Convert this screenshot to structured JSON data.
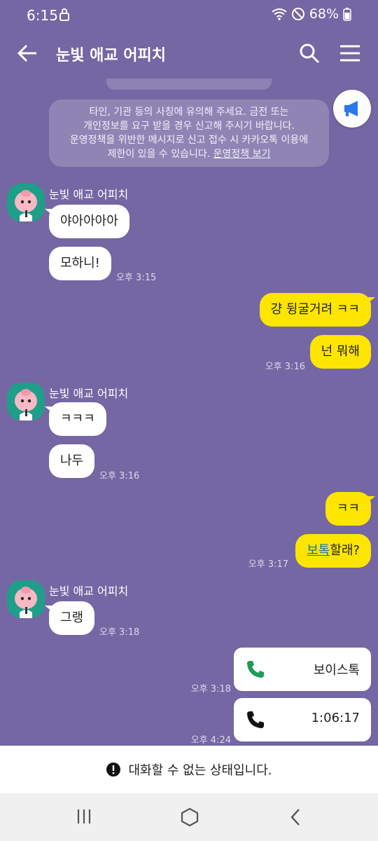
{
  "status_bar": {
    "time": "6:15",
    "battery": "68%"
  },
  "header": {
    "title": "눈빛 애교 어피치"
  },
  "notice": {
    "line1": "타인, 기관 등의 사칭에 유의해 주세요. 금전 또는",
    "line2": "개인정보를 요구 받을 경우 신고해 주시기 바랍니다.",
    "line3": "운영정책을 위반한 메시지로 신고 접수 시 카카오톡 이용에",
    "line4_prefix": "제한이 있을 수 있습니다. ",
    "line4_link": "운영정책 보기"
  },
  "messages": {
    "g1": {
      "sender": "눈빛 애교 어피치",
      "m1": "야아아아아",
      "m2": "모하니!",
      "time": "오후 3:15"
    },
    "g2": {
      "m1": "걍 뒹굴거려 ㅋㅋ",
      "m2": "넌 뭐해",
      "time": "오후 3:16"
    },
    "g3": {
      "sender": "눈빛 애교 어피치",
      "m1": "ㅋㅋㅋ",
      "m2": "나두",
      "time": "오후 3:16"
    },
    "g4": {
      "m1": "ㅋㅋ",
      "m2_link": "보톡",
      "m2_rest": "할래?",
      "time": "오후 3:17"
    },
    "g5": {
      "sender": "눈빛 애교 어피치",
      "m1": "그랭",
      "time": "오후 3:18"
    },
    "g6": {
      "call1_label": "보이스톡",
      "call1_time": "오후 3:18",
      "call2_label": "1:06:17",
      "call2_time": "오후 4:24"
    }
  },
  "footer": {
    "text": "대화할 수 없는 상태입니다."
  },
  "colors": {
    "background": "#7467a3",
    "my_bubble": "#fee500",
    "their_bubble": "#ffffff",
    "avatar_bg": "#1f9e8a",
    "call_green": "#1e9b57"
  },
  "icons": [
    "back-arrow-icon",
    "search-icon",
    "hamburger-menu-icon",
    "megaphone-icon",
    "phone-icon",
    "alert-icon",
    "recent-apps-icon",
    "home-icon",
    "nav-back-icon"
  ]
}
